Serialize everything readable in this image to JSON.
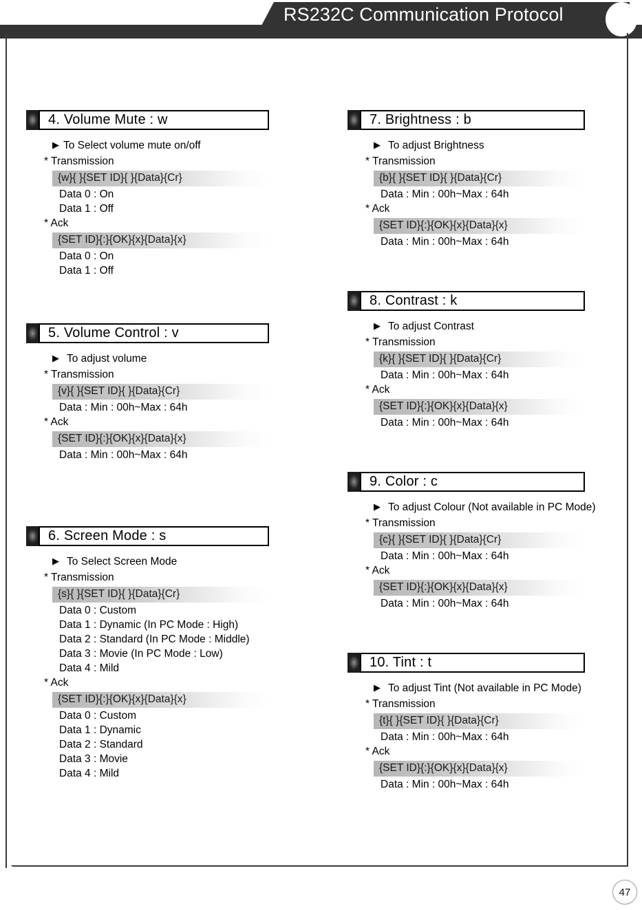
{
  "header": {
    "title": "RS232C Communication Protocol"
  },
  "page": {
    "number": "47"
  },
  "left_column": [
    {
      "title": "4. Volume Mute : w",
      "purpose": "To Select volume mute on/off",
      "transmission_label": "* Transmission",
      "transmission_code": "{w}{ }{SET ID}{ }{Data}{Cr}",
      "transmission_data": [
        "Data 0 : On",
        "Data 1 : Off"
      ],
      "ack_label": "* Ack",
      "ack_code": "{SET ID}{:}{OK}{x}{Data}{x}",
      "ack_data": [
        "Data 0 : On",
        "Data 1 : Off"
      ]
    },
    {
      "title": "5. Volume Control : v",
      "purpose": "To adjust volume",
      "transmission_label": "* Transmission",
      "transmission_code": "{v}{ }{SET ID}{ }{Data}{Cr}",
      "transmission_data": [
        "Data : Min : 00h~Max : 64h"
      ],
      "ack_label": "* Ack",
      "ack_code": "{SET ID}{:}{OK}{x}{Data}{x}",
      "ack_data": [
        "Data : Min : 00h~Max : 64h"
      ]
    },
    {
      "title": "6. Screen Mode : s",
      "purpose": "To Select Screen Mode",
      "transmission_label": "* Transmission",
      "transmission_code": "{s}{ }{SET ID}{ }{Data}{Cr}",
      "transmission_data": [
        "Data 0 : Custom",
        "Data 1 : Dynamic (In PC Mode : High)",
        "Data 2 : Standard (In PC Mode : Middle)",
        "Data 3 : Movie (In PC Mode : Low)",
        "Data 4 : Mild"
      ],
      "ack_label": "* Ack",
      "ack_code": "{SET ID}{:}{OK}{x}{Data}{x}",
      "ack_data": [
        "Data 0 : Custom",
        "Data 1 : Dynamic",
        "Data 2 : Standard",
        "Data 3 : Movie",
        "Data 4 : Mild"
      ]
    }
  ],
  "right_column": [
    {
      "title": "7. Brightness : b",
      "purpose": "To adjust Brightness",
      "transmission_label": "* Transmission",
      "transmission_code": "{b}{ }{SET ID}{ }{Data}{Cr}",
      "transmission_data": [
        "Data : Min : 00h~Max : 64h"
      ],
      "ack_label": "* Ack",
      "ack_code": "{SET ID}{:}{OK}{x}{Data}{x}",
      "ack_data": [
        "Data : Min : 00h~Max : 64h"
      ]
    },
    {
      "title": "8. Contrast : k",
      "purpose": "To adjust Contrast",
      "transmission_label": "* Transmission",
      "transmission_code": "{k}{ }{SET ID}{ }{Data}{Cr}",
      "transmission_data": [
        "Data : Min : 00h~Max : 64h"
      ],
      "ack_label": "* Ack",
      "ack_code": "{SET ID}{:}{OK}{x}{Data}{x}",
      "ack_data": [
        "Data : Min : 00h~Max : 64h"
      ]
    },
    {
      "title": "9. Color : c",
      "purpose": "To adjust Colour (Not available in PC Mode)",
      "transmission_label": "* Transmission",
      "transmission_code": "{c}{ }{SET ID}{ }{Data}{Cr}",
      "transmission_data": [
        "Data : Min : 00h~Max : 64h"
      ],
      "ack_label": "* Ack",
      "ack_code": "{SET ID}{:}{OK}{x}{Data}{x}",
      "ack_data": [
        "Data : Min : 00h~Max : 64h"
      ]
    },
    {
      "title": "10. Tint : t",
      "purpose": "To adjust Tint (Not available in PC Mode)",
      "transmission_label": "* Transmission",
      "transmission_code": "{t}{ }{SET ID}{ }{Data}{Cr}",
      "transmission_data": [
        "Data : Min : 00h~Max : 64h"
      ],
      "ack_label": "* Ack",
      "ack_code": "{SET ID}{:}{OK}{x}{Data}{x}",
      "ack_data": [
        "Data : Min : 00h~Max : 64h"
      ]
    }
  ],
  "icons": {
    "bullet": "▶"
  },
  "colors": {
    "header_bg": "#333333",
    "header_text": "#ffffff",
    "frame_border": "#3a3a3a",
    "code_gradient_start": "#b6b6b6",
    "code_gradient_end": "#ffffff"
  }
}
